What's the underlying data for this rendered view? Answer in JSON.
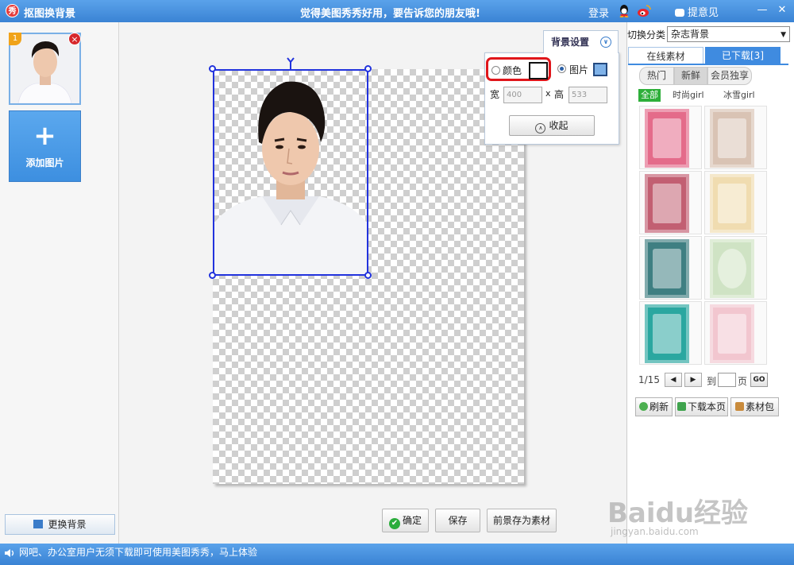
{
  "window": {
    "logo_char": "秀",
    "title": "抠图换背景",
    "slogan": "觉得美图秀秀好用，要告诉您的朋友哦!",
    "login": "登录",
    "feedback": "提意见",
    "minimize": "—",
    "close": "✕"
  },
  "left_panel": {
    "thumb_badge": "1",
    "thumb_close": "×",
    "add_photo_plus": "+",
    "add_photo_label": "添加图片",
    "change_bg_label": "更换背景"
  },
  "bg_settings": {
    "tab_label": "背景设置",
    "chevron": "∨",
    "color_label": "颜色",
    "image_label": "图片",
    "color_value": "#ffffff",
    "selected_mode": "图片",
    "width_label": "宽",
    "width_value": "400",
    "times": "x",
    "height_label": "高",
    "height_value": "533",
    "collapse_label": "收起"
  },
  "actions": {
    "confirm": "确定",
    "save": "保存",
    "save_foreground": "前景存为素材"
  },
  "right_panel": {
    "category_label": "切换分类",
    "category_value": "杂志背景",
    "tab_online": "在线素材",
    "tab_downloaded": "已下载[3]",
    "subtabs": [
      "热门",
      "新鲜",
      "会员独享"
    ],
    "active_subtab": "新鲜",
    "filters": [
      "全部",
      "时尚girl",
      "冰雪girl"
    ],
    "active_filter": "全部",
    "materials": [
      {
        "name": "ice-cream-poster",
        "color": "#e46b8a"
      },
      {
        "name": "ice-cream-poster-2",
        "color": "#d9c3b4"
      },
      {
        "name": "cupcake-poster",
        "color": "#c25f72"
      },
      {
        "name": "lace-frame",
        "color": "#f0dcb0"
      },
      {
        "name": "floral-frame-teal",
        "color": "#3f7f82"
      },
      {
        "name": "oval-frame",
        "color": "#cfe3c4"
      },
      {
        "name": "butterfly-frame",
        "color": "#2aa7a0"
      },
      {
        "name": "flower-frame-pink",
        "color": "#f2c6cf"
      }
    ],
    "page_current": "1/15",
    "page_prev": "◀",
    "page_next": "▶",
    "goto_label": "到",
    "page_unit": "页",
    "go": "GO",
    "refresh": "刷新",
    "download_page": "下载本页",
    "material_pack": "素材包"
  },
  "status_bar": {
    "message": "网吧、办公室用户无须下载即可使用美图秀秀，马上体验"
  },
  "watermark": {
    "brand": "Baidu经验",
    "url": "jingyan.baidu.com"
  }
}
